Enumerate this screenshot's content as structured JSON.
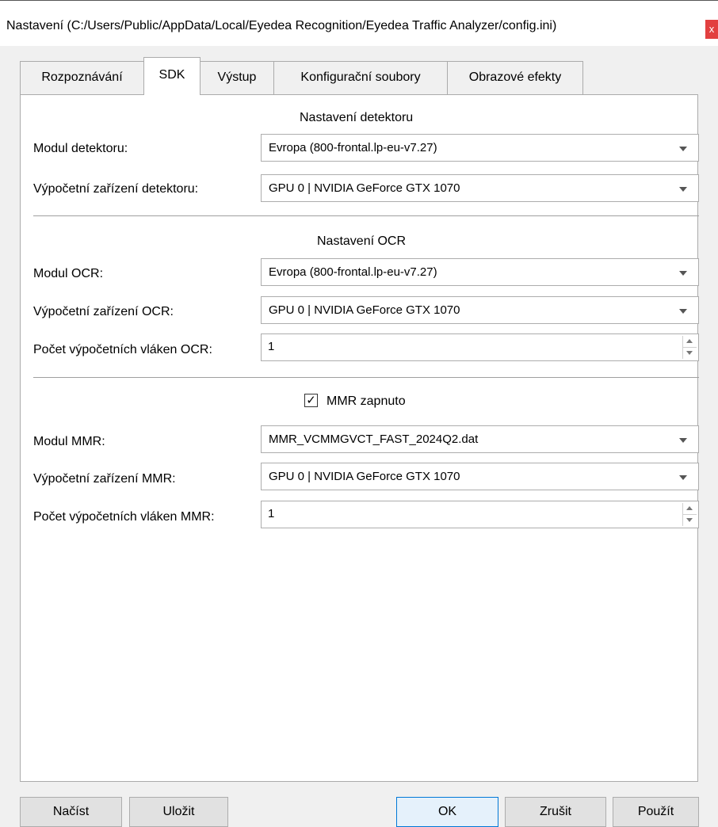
{
  "window": {
    "title": "Nastavení (C:/Users/Public/AppData/Local/Eyedea Recognition/Eyedea Traffic Analyzer/config.ini)",
    "close_label": "x"
  },
  "tabs": [
    {
      "label": "Rozpoznávání",
      "active": false
    },
    {
      "label": "SDK",
      "active": true
    },
    {
      "label": "Výstup",
      "active": false
    },
    {
      "label": "Konfigurační soubory",
      "active": false
    },
    {
      "label": "Obrazové efekty",
      "active": false
    }
  ],
  "detector": {
    "heading": "Nastavení detektoru",
    "module_label": "Modul detektoru:",
    "module_value": "Evropa (800-frontal.lp-eu-v7.27)",
    "device_label": "Výpočetní zařízení detektoru:",
    "device_value": "GPU 0 |  NVIDIA GeForce GTX 1070"
  },
  "ocr": {
    "heading": "Nastavení OCR",
    "module_label": "Modul OCR:",
    "module_value": "Evropa (800-frontal.lp-eu-v7.27)",
    "device_label": "Výpočetní zařízení OCR:",
    "device_value": "GPU 0 |  NVIDIA GeForce GTX 1070",
    "threads_label": "Počet výpočetních vláken OCR:",
    "threads_value": "1"
  },
  "mmr": {
    "enabled_label": "MMR zapnuto",
    "enabled": true,
    "check_mark": "✓",
    "module_label": "Modul MMR:",
    "module_value": "MMR_VCMMGVCT_FAST_2024Q2.dat",
    "device_label": "Výpočetní zařízení MMR:",
    "device_value": "GPU 0 |  NVIDIA GeForce GTX 1070",
    "threads_label": "Počet výpočetních vláken MMR:",
    "threads_value": "1"
  },
  "buttons": {
    "load": "Načíst",
    "save": "Uložit",
    "ok": "OK",
    "cancel": "Zrušit",
    "apply": "Použít"
  }
}
